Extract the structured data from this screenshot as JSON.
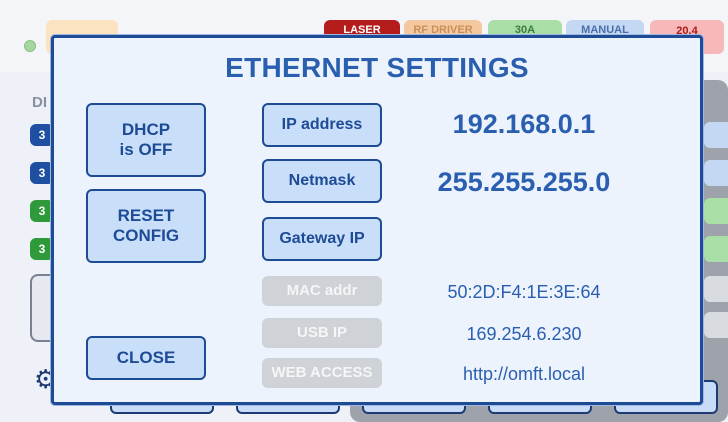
{
  "modal": {
    "title": "ETHERNET SETTINGS",
    "dhcp_button": "DHCP\nis OFF",
    "reset_button": "RESET\nCONFIG",
    "close_button": "CLOSE",
    "fields": [
      {
        "label": "IP address",
        "value": "192.168.0.1",
        "enabled": true
      },
      {
        "label": "Netmask",
        "value": "255.255.255.0",
        "enabled": true
      },
      {
        "label": "Gateway IP",
        "value": "",
        "enabled": true
      },
      {
        "label": "MAC addr",
        "value": "50:2D:F4:1E:3E:64",
        "enabled": false
      },
      {
        "label": "USB IP",
        "value": "169.254.6.230",
        "enabled": false
      },
      {
        "label": "WEB ACCESS",
        "value": "http://omft.local",
        "enabled": false
      }
    ]
  },
  "background": {
    "header_pills": [
      {
        "label": "LASER",
        "color": "#b51d1d"
      },
      {
        "label": "RF DRIVER",
        "color": "#f5c9a0"
      },
      {
        "label": "30A",
        "color": "#a9dfa6"
      },
      {
        "label": "MANUAL",
        "color": "#c4d8f4"
      },
      {
        "label": "20.4\ns",
        "color": "#f6b8b8"
      }
    ],
    "side_label": "DI",
    "side_tags": [
      {
        "label": "3",
        "color": "#1f4fa0"
      },
      {
        "label": "3",
        "color": "#1f4fa0"
      },
      {
        "label": "3",
        "color": "#2e9a3a"
      },
      {
        "label": "3",
        "color": "#2e9a3a"
      }
    ]
  }
}
